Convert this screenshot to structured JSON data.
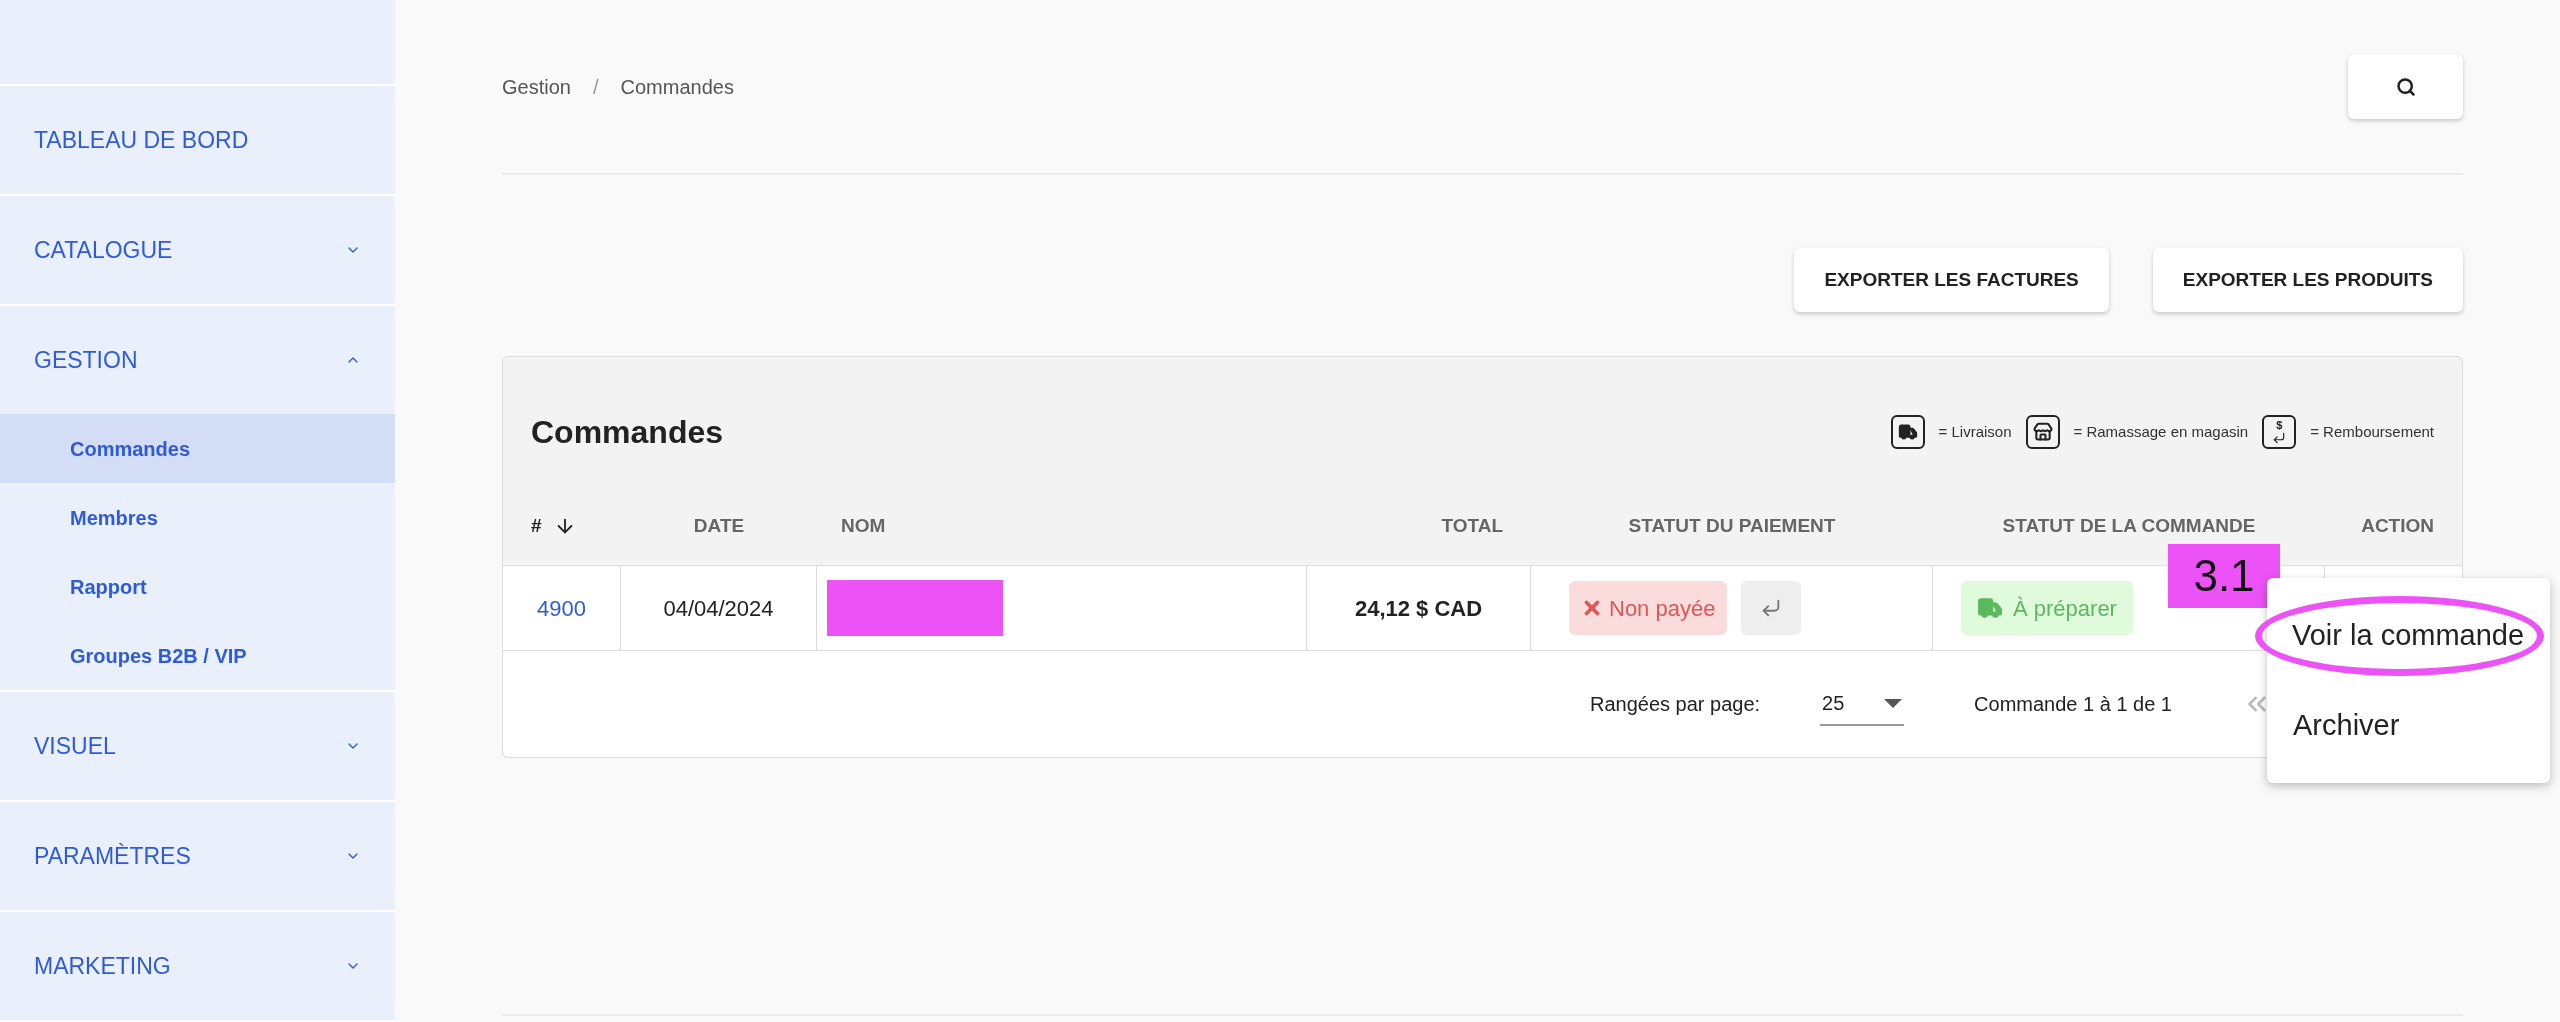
{
  "sidebar": {
    "items": [
      {
        "label": "TABLEAU DE BORD"
      },
      {
        "label": "CATALOGUE",
        "expanded": false
      },
      {
        "label": "GESTION",
        "expanded": true,
        "children": [
          {
            "label": "Commandes",
            "selected": true
          },
          {
            "label": "Membres",
            "selected": false
          },
          {
            "label": "Rapport",
            "selected": false
          },
          {
            "label": "Groupes B2B / VIP",
            "selected": false
          }
        ]
      },
      {
        "label": "VISUEL",
        "expanded": false
      },
      {
        "label": "PARAMÈTRES",
        "expanded": false
      },
      {
        "label": "MARKETING",
        "expanded": false
      }
    ]
  },
  "breadcrumb": [
    "Gestion",
    "Commandes"
  ],
  "breadcrumb_separator": "/",
  "actions": [
    "EXPORTER LES FACTURES",
    "EXPORTER LES PRODUITS"
  ],
  "card": {
    "title": "Commandes",
    "legend": [
      {
        "kind": "delivery",
        "label": "= Livraison"
      },
      {
        "kind": "store",
        "label": "= Ramassage en magasin"
      },
      {
        "kind": "refund",
        "symbol": "$",
        "label": "= Remboursement"
      }
    ],
    "columns": [
      "#",
      "DATE",
      "NOM",
      "TOTAL",
      "STATUT DU PAIEMENT",
      "STATUT DE LA COMMANDE",
      "ACTION"
    ],
    "rows": [
      {
        "number": "4900",
        "date": "04/04/2024",
        "total": "24,12 $ CAD",
        "payment_status": "Non payée",
        "paid": false,
        "order_status": "À préparer"
      }
    ],
    "pagination": {
      "rows_label": "Rangées par page:",
      "rows_value": "25",
      "range": "Commande 1 à 1 de 1"
    }
  },
  "annotation": {
    "label": "3.1"
  },
  "menu": {
    "items": [
      {
        "label": "Voir la commande",
        "circled": true
      },
      {
        "label": "Archiver",
        "circled": false
      }
    ]
  }
}
